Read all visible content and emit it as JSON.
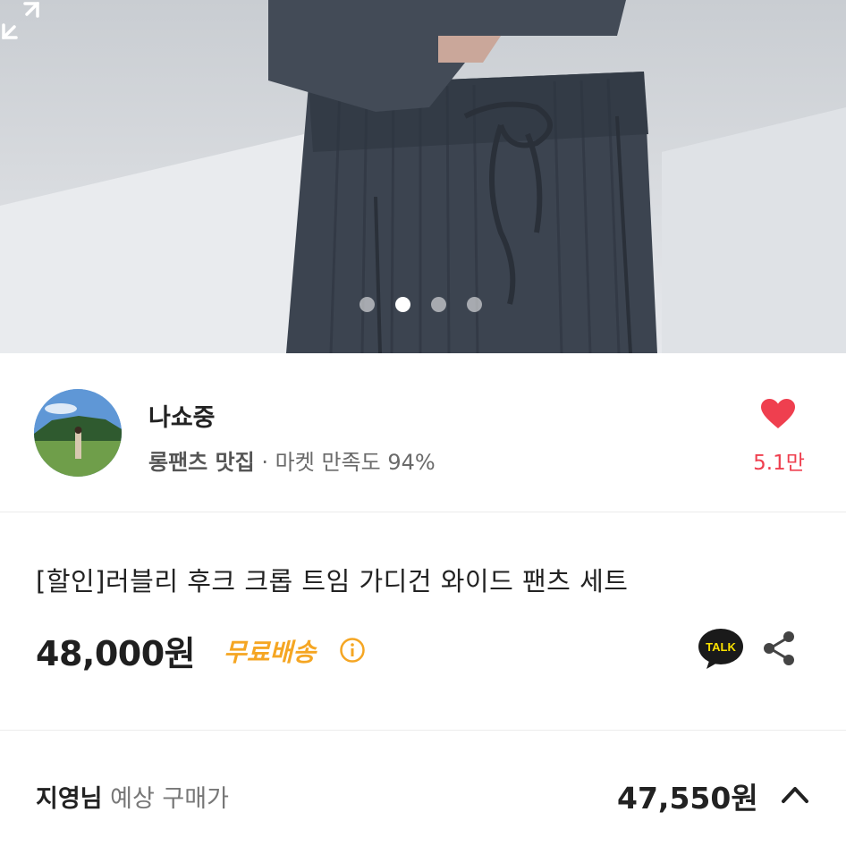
{
  "carousel": {
    "total": 4,
    "active_index": 1
  },
  "seller": {
    "name": "나쇼중",
    "tagline": "롱팬츠 맛집",
    "separator": " · ",
    "satisfaction": "마켓 만족도 94%",
    "likes": "5.1만"
  },
  "product": {
    "title": "[할인]러블리 후크 크롭 트임 가디건 와이드 팬츠 세트",
    "price": "48,000원",
    "shipping": "무료배송",
    "kakao_badge": "TALK"
  },
  "expected": {
    "user": "지영님",
    "label": "예상 구매가",
    "price": "47,550원"
  },
  "colors": {
    "heart": "#ef3f4f",
    "free_shipping": "#f5a623",
    "kakao_yellow": "#fae100",
    "kakao_black": "#1a1a1a"
  },
  "icons": [
    "expand-icon",
    "heart-icon",
    "info-icon",
    "kakaotalk-icon",
    "share-icon",
    "chevron-up-icon"
  ]
}
